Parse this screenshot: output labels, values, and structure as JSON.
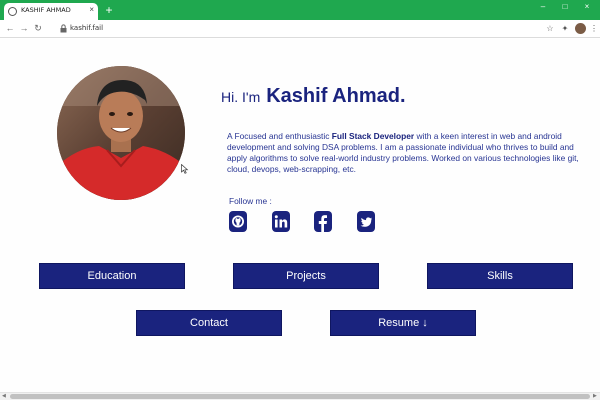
{
  "browser": {
    "tab_title": "KASHIF AHMAD",
    "tab_close": "×",
    "new_tab": "+",
    "window_controls": [
      "–",
      "□",
      "×"
    ],
    "nav": [
      "←",
      "→",
      "↻"
    ],
    "url": "kashif.fail",
    "toolbar_icons": [
      "star-icon",
      "extensions-icon",
      "profile-avatar",
      "menu-icon"
    ]
  },
  "hero": {
    "greeting_prefix": "Hi. I'm",
    "name": "Kashif Ahmad.",
    "bio_before": "A Focused and enthusiastic ",
    "bio_strong": "Full Stack Developer",
    "bio_after": " with a keen interest in web and android development and solving DSA problems. I am a passionate individual who thrives to build and apply algorithms to solve real-world industry problems. Worked on various technologies like git, cloud, devops, web-scrapping, etc.",
    "follow_label": "Follow me :"
  },
  "social": [
    "github-icon",
    "linkedin-icon",
    "facebook-icon",
    "twitter-icon"
  ],
  "buttons": {
    "education": "Education",
    "projects": "Projects",
    "skills": "Skills",
    "contact": "Contact",
    "resume": "Resume ↓"
  },
  "colors": {
    "primary": "#1a237e",
    "browser_green": "#1fa84f"
  }
}
